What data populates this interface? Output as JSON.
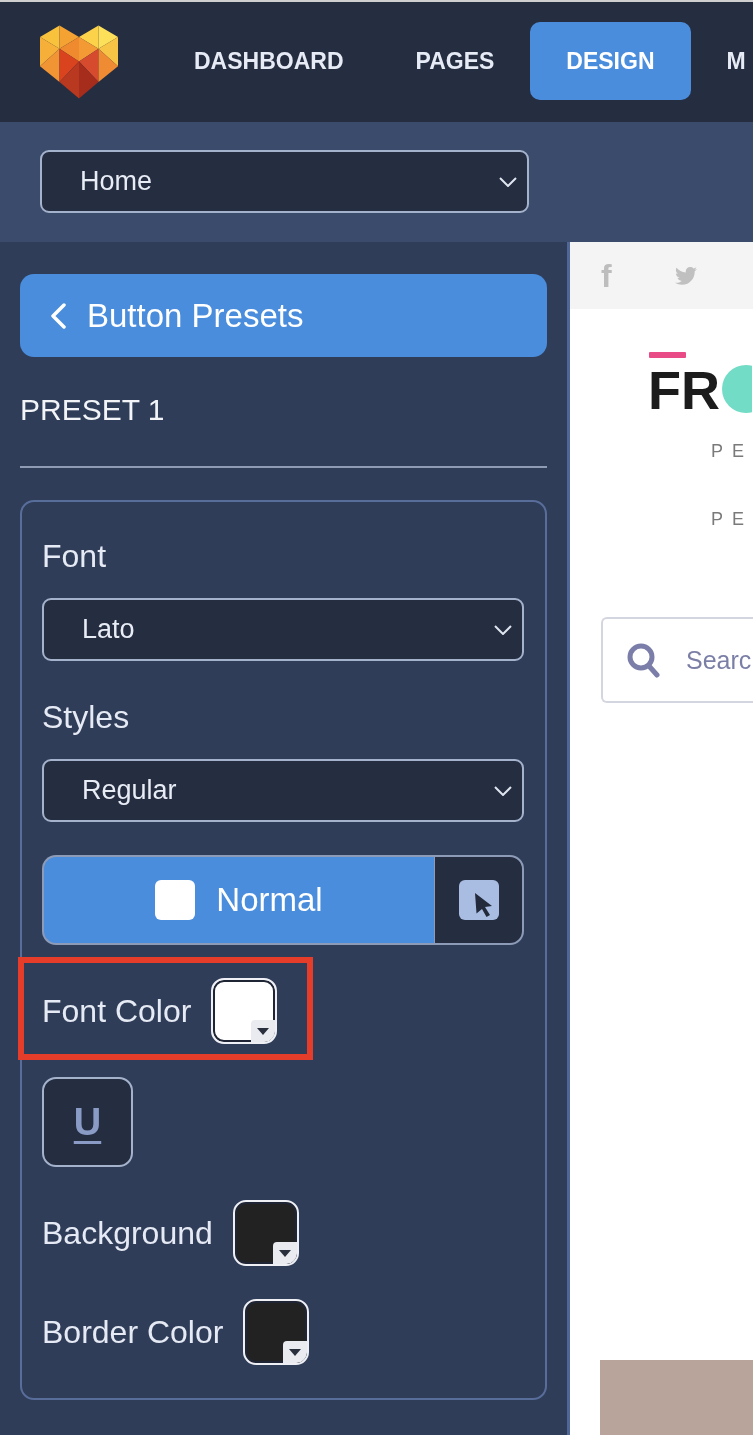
{
  "top_nav": {
    "tabs": [
      {
        "label": "DASHBOARD",
        "selected": false
      },
      {
        "label": "PAGES",
        "selected": false
      },
      {
        "label": "DESIGN",
        "selected": true
      },
      {
        "label": "M",
        "selected": false
      }
    ]
  },
  "page_select": {
    "value": "Home"
  },
  "sidebar": {
    "back_button": {
      "label": "Button Presets"
    },
    "title": "PRESET 1",
    "controls": [
      {
        "kind": "select",
        "label": "Font",
        "value": "Lato"
      },
      {
        "kind": "select",
        "label": "Styles",
        "value": "Regular"
      },
      {
        "kind": "state_switch",
        "options": [
          {
            "kind": "normal",
            "label": "Normal",
            "selected": true
          },
          {
            "kind": "hover",
            "selected": false
          }
        ]
      },
      {
        "kind": "color",
        "label": "Font Color",
        "color": "#ffffff",
        "highlighted": true
      },
      {
        "kind": "underline_toggle",
        "symbol": "U",
        "on": false
      },
      {
        "kind": "color",
        "label": "Background",
        "color": "#222222",
        "highlighted": false
      },
      {
        "kind": "color",
        "label": "Border Color",
        "color": "#222222",
        "highlighted": false
      }
    ]
  },
  "preview": {
    "social_icons": [
      {
        "kind": "letter",
        "text": "f"
      },
      {
        "kind": "bird"
      }
    ],
    "logo_text": "FR",
    "taglines": [
      "PE",
      "PE"
    ],
    "search": {
      "placeholder": "Searc"
    }
  }
}
